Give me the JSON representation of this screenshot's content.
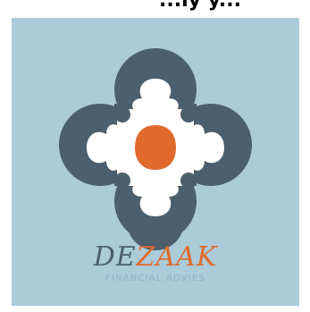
{
  "top_text": "...ly y...",
  "logo": {
    "wordmark_part1": "DE",
    "wordmark_part2": "ZAAK",
    "tagline": "FINANCIAL ADVIES",
    "icon": "flower-emblem-icon"
  },
  "colors": {
    "background": "#abcbd9",
    "dark": "#4b5f6d",
    "accent": "#e06a2c",
    "petal": "#ffffff",
    "tagline": "#8fb1c1"
  }
}
